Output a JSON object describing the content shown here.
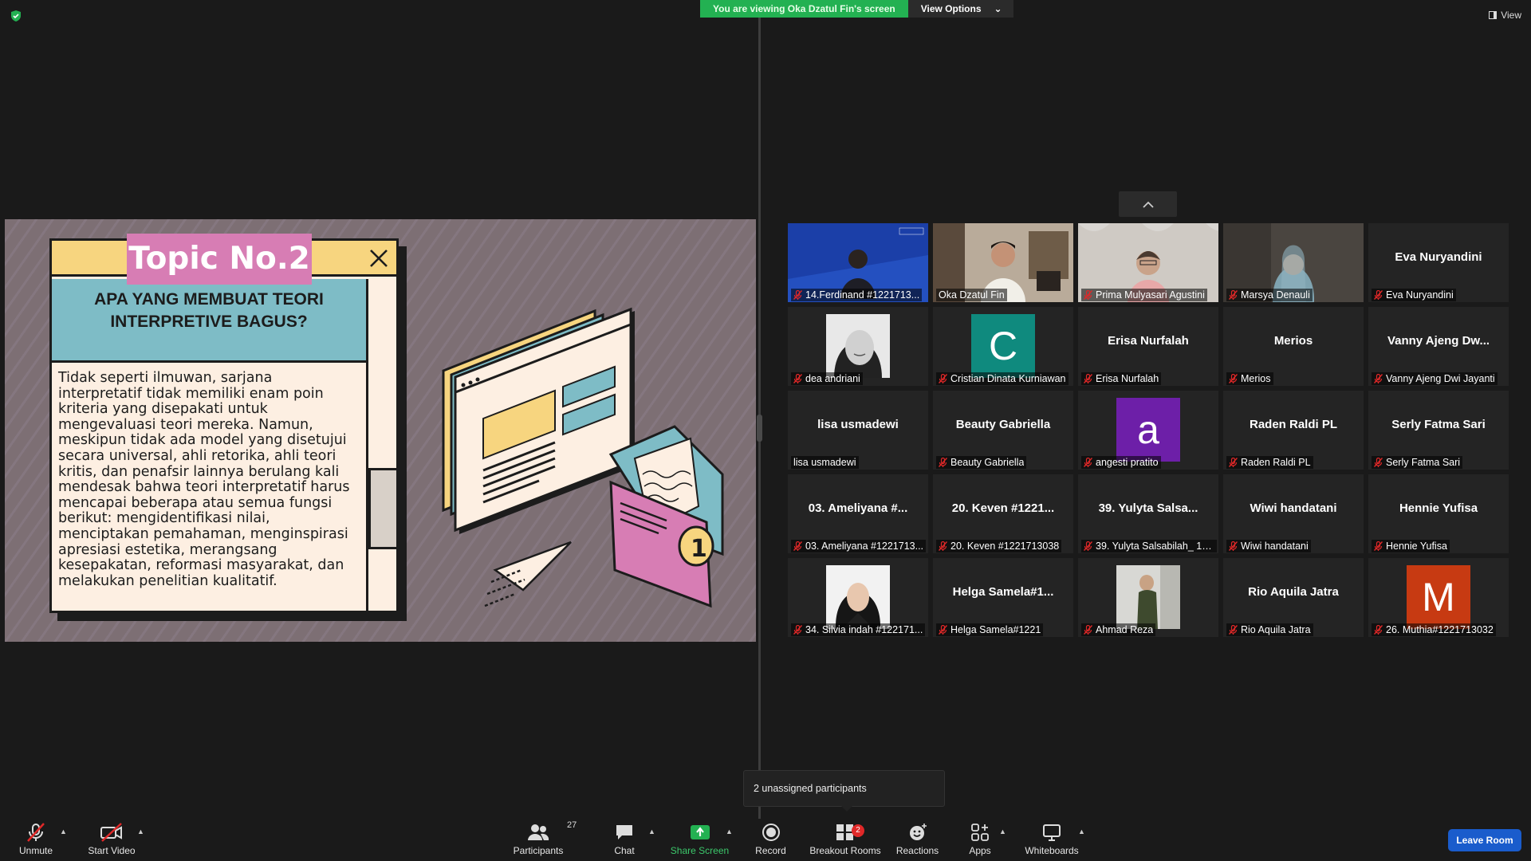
{
  "banner": {
    "viewing_text": "You are viewing Oka Dzatul Fin's screen",
    "view_options_label": "View Options",
    "view_label": "View"
  },
  "slide": {
    "topic_title": "Topic No.2",
    "heading": "APA YANG MEMBUAT TEORI INTERPRETIVE BAGUS?",
    "body": "Tidak seperti ilmuwan, sarjana interpretatif tidak memiliki enam poin kriteria yang disepakati untuk mengevaluasi teori mereka. Namun, meskipun tidak ada model yang disetujui secara universal, ahli retorika, ahli teori kritis, dan penafsir lainnya berulang kali mendesak bahwa teori interpretatif harus mencapai beberapa atau semua fungsi berikut: mengidentifikasi nilai, menciptakan pemahaman, menginspirasi apresiasi estetika, merangsang kesepakatan, reformasi masyarakat, dan melakukan penelitian kualitatif.",
    "colors": {
      "background": "#7d6f74",
      "title_bar": "#f7d57f",
      "topic_tag": "#d77db4",
      "heading_bg": "#7ebcc6",
      "paper": "#fdefe2"
    }
  },
  "participants_tiles": [
    {
      "big": "",
      "label": "14.Ferdinand #1221713...",
      "kind": "video",
      "video": "ferdinand"
    },
    {
      "big": "",
      "label": "Oka Dzatul Fin",
      "kind": "video",
      "video": "oka",
      "nomute": true
    },
    {
      "big": "",
      "label": "Prima Mulyasari Agustini",
      "kind": "video",
      "video": "prima"
    },
    {
      "big": "",
      "label": "Marsya Denauli",
      "kind": "video",
      "video": "marsya"
    },
    {
      "big": "Eva Nuryandini",
      "label": "Eva Nuryandini",
      "kind": "name"
    },
    {
      "big": "",
      "label": "dea andriani",
      "kind": "photo",
      "photo": "dea"
    },
    {
      "big": "",
      "label": "Cristian Dinata Kurniawan",
      "kind": "letter",
      "letter": "C",
      "color": "#0f8a7e"
    },
    {
      "big": "Erisa Nurfalah",
      "label": "Erisa Nurfalah",
      "kind": "name"
    },
    {
      "big": "Merios",
      "label": "Merios",
      "kind": "name"
    },
    {
      "big": "Vanny Ajeng Dw...",
      "label": "Vanny Ajeng Dwi Jayanti",
      "kind": "name"
    },
    {
      "big": "lisa usmadewi",
      "label": "lisa usmadewi",
      "kind": "name",
      "nomute": true
    },
    {
      "big": "Beauty Gabriella",
      "label": "Beauty Gabriella",
      "kind": "name"
    },
    {
      "big": "",
      "label": "angesti pratito",
      "kind": "letter",
      "letter": "a",
      "color": "#6d1fa8"
    },
    {
      "big": "Raden Raldi PL",
      "label": "Raden Raldi PL",
      "kind": "name"
    },
    {
      "big": "Serly Fatma Sari",
      "label": "Serly Fatma Sari",
      "kind": "name"
    },
    {
      "big": "03. Ameliyana #...",
      "label": "03. Ameliyana #1221713...",
      "kind": "name"
    },
    {
      "big": "20. Keven #1221...",
      "label": "20. Keven #1221713038",
      "kind": "name"
    },
    {
      "big": "39. Yulyta Salsa...",
      "label": "39. Yulyta Salsabilah_ 12...",
      "kind": "name"
    },
    {
      "big": "Wiwi handatani",
      "label": "Wiwi handatani",
      "kind": "name"
    },
    {
      "big": "Hennie Yufisa",
      "label": "Hennie Yufisa",
      "kind": "name"
    },
    {
      "big": "",
      "label": "34. Silvia indah #122171...",
      "kind": "photo",
      "photo": "silvia"
    },
    {
      "big": "Helga  Samela#1...",
      "label": "Helga Samela#1221",
      "kind": "name"
    },
    {
      "big": "",
      "label": "Ahmad Reza",
      "kind": "photo",
      "photo": "ahmad"
    },
    {
      "big": "Rio Aquila Jatra",
      "label": "Rio Aquila Jatra",
      "kind": "name"
    },
    {
      "big": "",
      "label": "26. Muthia#1221713032",
      "kind": "letter",
      "letter": "M",
      "color": "#c73a12"
    }
  ],
  "popup": {
    "text": "2 unassigned participants"
  },
  "toolbar": {
    "unmute": "Unmute",
    "start_video": "Start Video",
    "participants": "Participants",
    "participants_count": "27",
    "chat": "Chat",
    "share_screen": "Share Screen",
    "record": "Record",
    "breakout_rooms": "Breakout Rooms",
    "breakout_badge": "2",
    "reactions": "Reactions",
    "apps": "Apps",
    "whiteboards": "Whiteboards",
    "leave": "Leave Room"
  },
  "icons": [
    "shield-icon",
    "chevron-down-icon",
    "gallery-view-icon",
    "close-icon",
    "chevron-up-icon",
    "mic-muted-icon",
    "video-off-icon",
    "participants-icon",
    "chat-icon",
    "share-screen-icon",
    "record-icon",
    "breakout-rooms-icon",
    "reactions-icon",
    "apps-icon",
    "whiteboard-icon"
  ],
  "colors": {
    "accent_green": "#23b152",
    "leave_blue": "#1a5ccc",
    "muted_red": "#e02828"
  }
}
